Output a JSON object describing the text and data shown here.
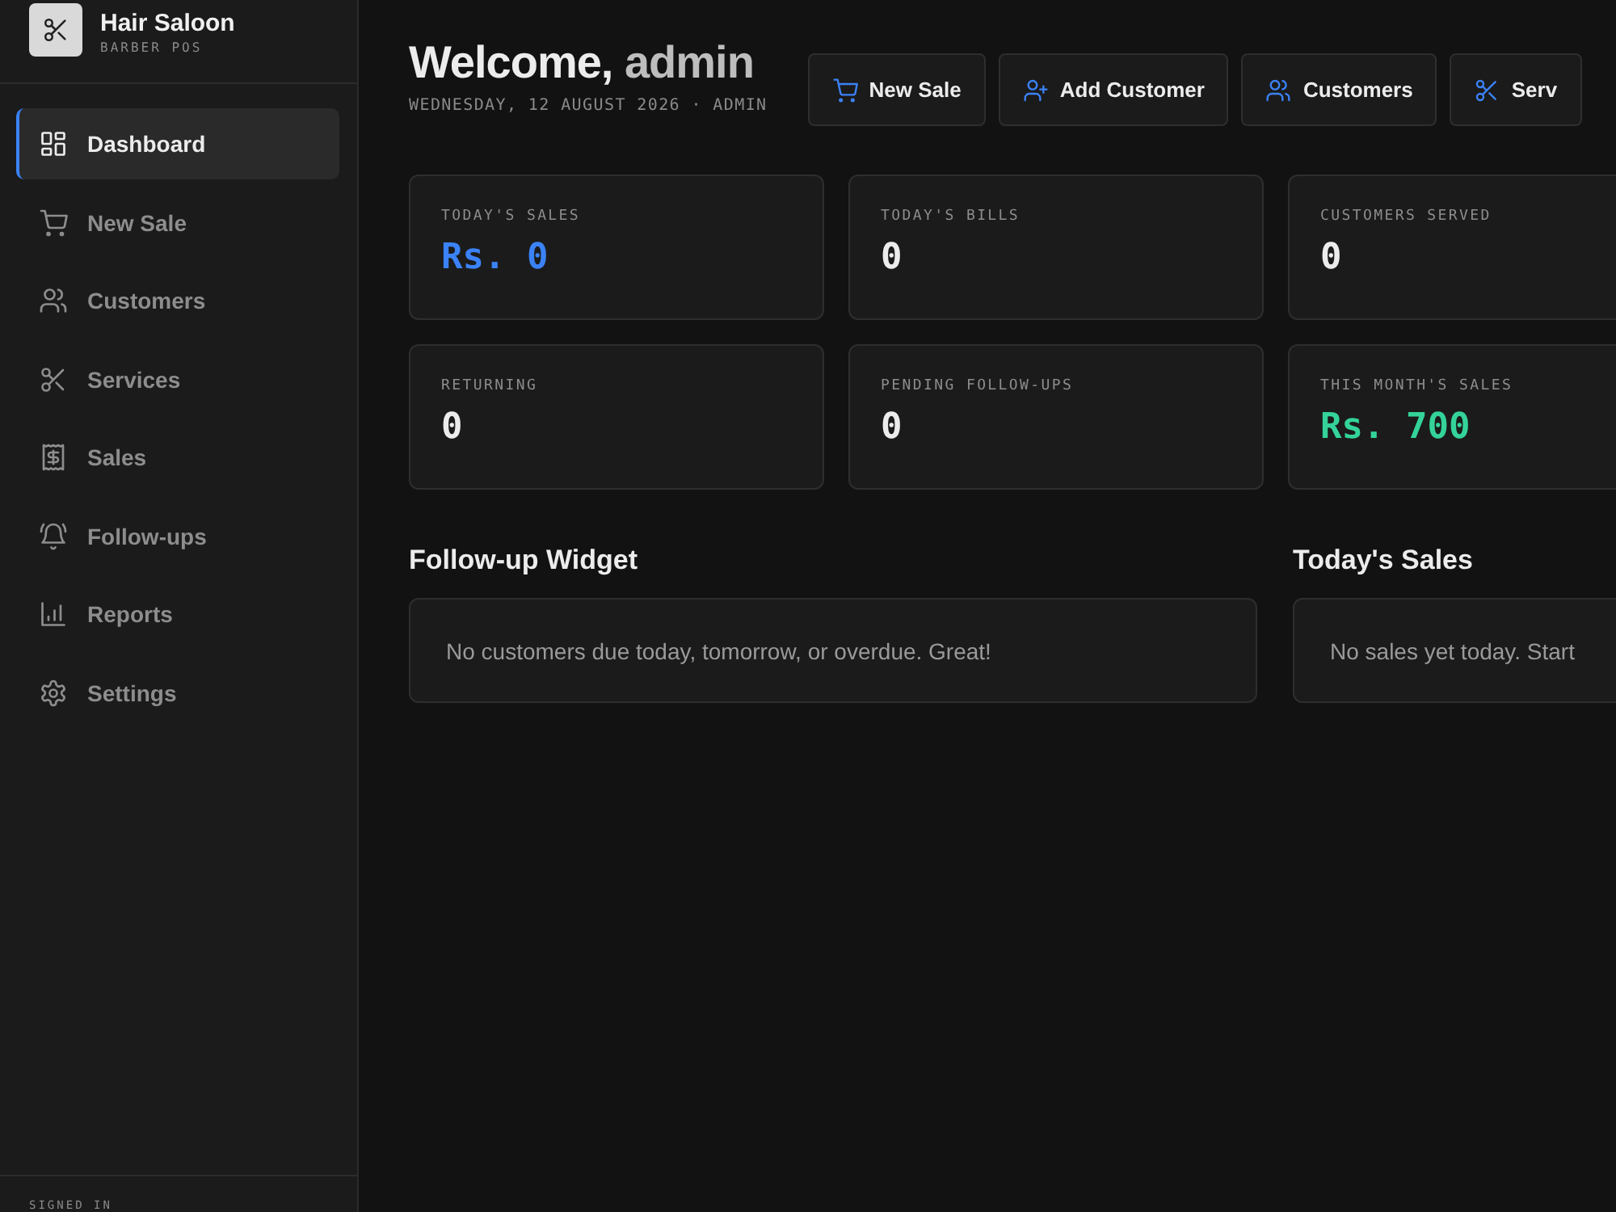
{
  "brand": {
    "title": "Hair Saloon",
    "subtitle": "BARBER POS"
  },
  "nav": [
    {
      "label": "Dashboard",
      "selected": true
    },
    {
      "label": "New Sale",
      "selected": false
    },
    {
      "label": "Customers",
      "selected": false
    },
    {
      "label": "Services",
      "selected": false
    },
    {
      "label": "Sales",
      "selected": false
    },
    {
      "label": "Follow-ups",
      "selected": false
    },
    {
      "label": "Reports",
      "selected": false
    },
    {
      "label": "Settings",
      "selected": false
    }
  ],
  "sidebar_footer": {
    "label": "SIGNED IN"
  },
  "header": {
    "greeting": "Welcome,",
    "user": "admin",
    "date": "WEDNESDAY, 12 AUGUST 2026 · ADMIN"
  },
  "actions": [
    {
      "label": "New Sale"
    },
    {
      "label": "Add Customer"
    },
    {
      "label": "Customers"
    },
    {
      "label": "Serv"
    }
  ],
  "stats": [
    {
      "label": "TODAY'S SALES",
      "value": "Rs. 0",
      "color": "#3b82f6"
    },
    {
      "label": "TODAY'S BILLS",
      "value": "0",
      "color": "#ececec"
    },
    {
      "label": "CUSTOMERS SERVED",
      "value": "0",
      "color": "#ececec"
    },
    {
      "label": "RETURNING",
      "value": "0",
      "color": "#ececec"
    },
    {
      "label": "PENDING FOLLOW-UPS",
      "value": "0",
      "color": "#ececec"
    },
    {
      "label": "THIS MONTH'S SALES",
      "value": "Rs. 700",
      "color": "#34d399"
    }
  ],
  "widgets": [
    {
      "title": "Follow-up Widget",
      "message": "No customers due today, tomorrow, or overdue. Great!"
    },
    {
      "title": "Today's Sales",
      "message": "No sales yet today. Start"
    }
  ]
}
